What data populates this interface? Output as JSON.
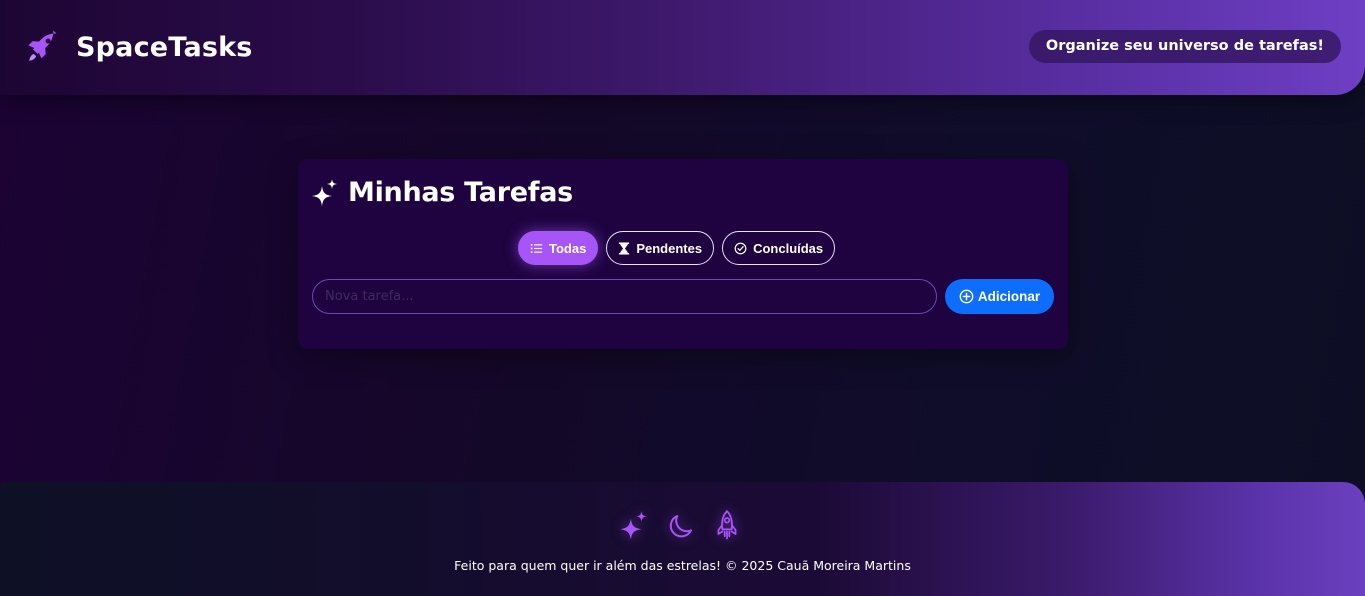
{
  "header": {
    "brand_name": "SpaceTasks",
    "slogan": "Organize seu universo de tarefas!",
    "brand_icon": "rocket-icon"
  },
  "card": {
    "title": "Minhas Tarefas",
    "title_icon": "sparkles-icon",
    "filters": [
      {
        "label": "Todas",
        "icon": "list-icon",
        "active": true
      },
      {
        "label": "Pendentes",
        "icon": "hourglass-icon",
        "active": false
      },
      {
        "label": "Concluídas",
        "icon": "check-circle-icon",
        "active": false
      }
    ],
    "input": {
      "placeholder": "Nova tarefa...",
      "value": ""
    },
    "add_label": "Adicionar"
  },
  "footer": {
    "icons": [
      "sparkles-icon",
      "moon-icon",
      "rocket-icon"
    ],
    "text": "Feito para quem quer ir além das estrelas! © 2025 Cauã Moreira Martins"
  },
  "colors": {
    "accent": "#a855f7",
    "primary_button": "#0d6efd",
    "card_bg": "#1e0340"
  }
}
